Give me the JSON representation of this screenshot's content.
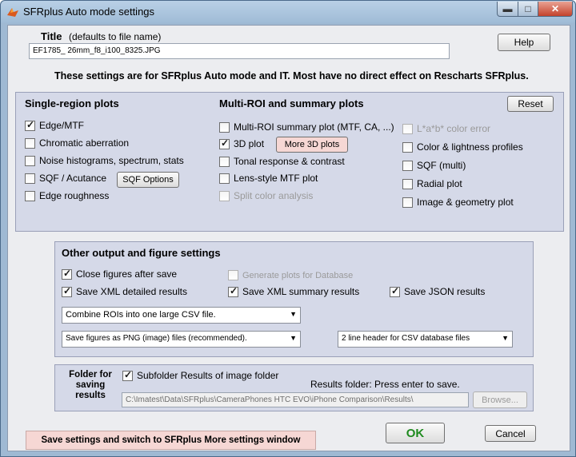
{
  "window": {
    "title": "SFRplus Auto mode settings"
  },
  "title_section": {
    "label": "Title",
    "hint": "(defaults to file name)",
    "value": "EF1785_ 26mm_f8_i100_8325.JPG"
  },
  "help_label": "Help",
  "notice": "These settings are for SFRplus Auto mode and IT. Most have no direct effect on Rescharts SFRplus.",
  "single_region": {
    "heading": "Single-region plots",
    "items": [
      {
        "label": "Edge/MTF",
        "checked": true
      },
      {
        "label": "Chromatic aberration",
        "checked": false
      },
      {
        "label": "Noise histograms, spectrum, stats",
        "checked": false
      },
      {
        "label": "SQF / Acutance",
        "checked": false
      },
      {
        "label": "Edge roughness",
        "checked": false
      }
    ],
    "sqf_options_label": "SQF Options"
  },
  "multi_roi": {
    "heading": "Multi-ROI and summary plots",
    "col1": [
      {
        "label": "Multi-ROI summary plot (MTF, CA, ...)",
        "checked": false,
        "disabled": false
      },
      {
        "label": "3D plot",
        "checked": true,
        "disabled": false
      },
      {
        "label": "Tonal response & contrast",
        "checked": false,
        "disabled": false
      },
      {
        "label": "Lens-style MTF plot",
        "checked": false,
        "disabled": false
      },
      {
        "label": "Split color analysis",
        "checked": false,
        "disabled": true
      }
    ],
    "col2": [
      {
        "label": "L*a*b* color error",
        "checked": false,
        "disabled": true
      },
      {
        "label": "Color & lightness profiles",
        "checked": false,
        "disabled": false
      },
      {
        "label": "SQF (multi)",
        "checked": false,
        "disabled": false
      },
      {
        "label": "Radial plot",
        "checked": false,
        "disabled": false
      },
      {
        "label": "Image & geometry plot",
        "checked": false,
        "disabled": false
      }
    ],
    "more_3d_label": "More 3D plots",
    "reset_label": "Reset"
  },
  "other": {
    "heading": "Other output and figure settings",
    "close_figures": {
      "label": "Close figures after save",
      "checked": true
    },
    "generate_db": {
      "label": "Generate plots for Database",
      "checked": false
    },
    "save_xml_detailed": {
      "label": "Save XML detailed results",
      "checked": true
    },
    "save_xml_summary": {
      "label": "Save XML summary results",
      "checked": true
    },
    "save_json": {
      "label": "Save JSON results",
      "checked": true
    },
    "combine_select": "Combine ROIs into one large CSV file.",
    "figures_select": "Save figures as PNG (image) files (recommended).",
    "header_select": "2 line header for CSV database files"
  },
  "folder": {
    "label_line1": "Folder for",
    "label_line2": "saving",
    "label_line3": "results",
    "subfolder": {
      "label": "Subfolder Results of image folder",
      "checked": true
    },
    "results_hint": "Results folder:  Press enter to save.",
    "path": "C:\\Imatest\\Data\\SFRplus\\CameraPhones HTC EVO\\iPhone Comparison\\Results\\",
    "browse_label": "Browse..."
  },
  "bottom": {
    "save_switch_label": "Save settings and switch to SFRplus More settings window",
    "ok_label": "OK",
    "cancel_label": "Cancel"
  },
  "colors": {
    "ok_text": "#1e8a1e",
    "save_switch_bg": "#f6d7d4",
    "panel_bg": "#d5d9e8"
  }
}
